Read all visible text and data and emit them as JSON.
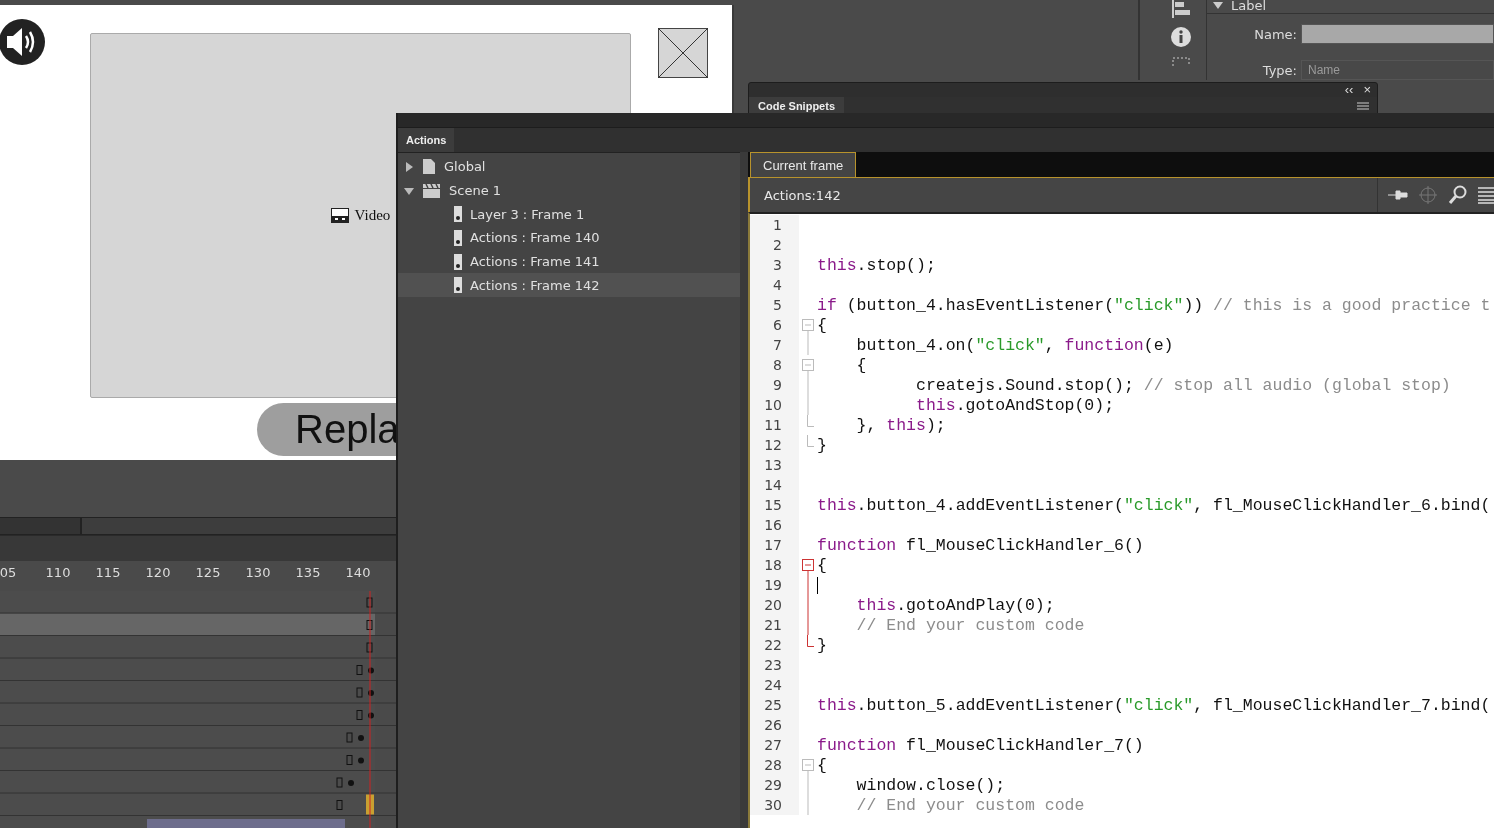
{
  "stage": {
    "video_label": "Video",
    "replay_button": "Repla"
  },
  "timeline": {
    "ruler": [
      "05",
      "110",
      "115",
      "120",
      "125",
      "130",
      "135",
      "140"
    ]
  },
  "properties": {
    "section": {
      "title": "Label",
      "expanded": true
    },
    "fields": [
      {
        "label": "Name:",
        "filled": true
      },
      {
        "label": "Type:",
        "filled": false,
        "placeholder": "Name"
      }
    ]
  },
  "code_snippets_panel": {
    "collapse": "‹‹",
    "close": "×",
    "tab": "Code Snippets"
  },
  "actions_panel": {
    "tab": "Actions",
    "tree": [
      {
        "label": "Global",
        "kind": "file",
        "expanded": false,
        "selected": false
      },
      {
        "label": "Scene 1",
        "kind": "scene",
        "expanded": true,
        "selected": false,
        "children": [
          {
            "label": "Layer 3 : Frame 1",
            "kind": "frame",
            "selected": false
          },
          {
            "label": "Actions : Frame 140",
            "kind": "frame",
            "selected": false
          },
          {
            "label": "Actions : Frame 141",
            "kind": "frame",
            "selected": false
          },
          {
            "label": "Actions : Frame 142",
            "kind": "frame",
            "selected": true
          }
        ]
      }
    ],
    "editor_tab": {
      "label": "Current frame",
      "selected": true
    },
    "location": "Actions:142",
    "code": [
      {
        "n": "1"
      },
      {
        "n": "2"
      },
      {
        "n": "3",
        "tokens": [
          {
            "kind": "kw",
            "s": "this"
          },
          {
            "kind": "p",
            "s": ".stop();"
          }
        ]
      },
      {
        "n": "4"
      },
      {
        "n": "5",
        "tokens": [
          {
            "kind": "kw",
            "s": "if"
          },
          {
            "kind": "p",
            "s": " (button_4.hasEventListener("
          },
          {
            "kind": "str",
            "s": "\"click\""
          },
          {
            "kind": "p",
            "s": ")) "
          },
          {
            "kind": "cmt",
            "s": "// this is a good practice t"
          }
        ]
      },
      {
        "n": "6",
        "fold": true,
        "in_fold": true,
        "tokens": [
          {
            "kind": "p",
            "s": "{"
          }
        ]
      },
      {
        "n": "7",
        "in_fold": true,
        "tokens": [
          {
            "kind": "p",
            "s": "    button_4.on("
          },
          {
            "kind": "str",
            "s": "\"click\""
          },
          {
            "kind": "p",
            "s": ", "
          },
          {
            "kind": "kw",
            "s": "function"
          },
          {
            "kind": "p",
            "s": "(e)"
          }
        ]
      },
      {
        "n": "8",
        "fold": true,
        "in_fold": true,
        "tokens": [
          {
            "kind": "p",
            "s": "    {"
          }
        ]
      },
      {
        "n": "9",
        "in_fold": true,
        "tokens": [
          {
            "kind": "p",
            "s": "          createjs.Sound.stop(); "
          },
          {
            "kind": "cmt",
            "s": "// stop all audio (global stop)"
          }
        ]
      },
      {
        "n": "10",
        "in_fold": true,
        "tokens": [
          {
            "kind": "kw",
            "s": "          this"
          },
          {
            "kind": "p",
            "s": ".gotoAndStop(0);"
          }
        ]
      },
      {
        "n": "11",
        "in_fold": true,
        "fold_end": true,
        "tokens": [
          {
            "kind": "p",
            "s": "    }, "
          },
          {
            "kind": "kw",
            "s": "this"
          },
          {
            "kind": "p",
            "s": ");"
          }
        ]
      },
      {
        "n": "12",
        "in_fold": true,
        "fold_end": true,
        "tokens": [
          {
            "kind": "p",
            "s": "}"
          }
        ]
      },
      {
        "n": "13"
      },
      {
        "n": "14"
      },
      {
        "n": "15",
        "tokens": [
          {
            "kind": "kw",
            "s": "this"
          },
          {
            "kind": "p",
            "s": ".button_4.addEventListener("
          },
          {
            "kind": "str",
            "s": "\"click\""
          },
          {
            "kind": "p",
            "s": ", fl_MouseClickHandler_6.bind("
          }
        ]
      },
      {
        "n": "16"
      },
      {
        "n": "17",
        "tokens": [
          {
            "kind": "kw",
            "s": "function"
          },
          {
            "kind": "p",
            "s": " fl_MouseClickHandler_6()"
          }
        ]
      },
      {
        "n": "18",
        "fold": true,
        "in_fold": true,
        "active": true,
        "tokens": [
          {
            "kind": "p",
            "s": "{"
          }
        ]
      },
      {
        "n": "19",
        "in_fold": true,
        "active": true,
        "cursor": true
      },
      {
        "n": "20",
        "in_fold": true,
        "active": true,
        "tokens": [
          {
            "kind": "kw",
            "s": "    this"
          },
          {
            "kind": "p",
            "s": ".gotoAndPlay(0);"
          }
        ]
      },
      {
        "n": "21",
        "in_fold": true,
        "active": true,
        "tokens": [
          {
            "kind": "cmt",
            "s": "    // End your custom code"
          }
        ]
      },
      {
        "n": "22",
        "in_fold": true,
        "fold_end": true,
        "active": true,
        "tokens": [
          {
            "kind": "p",
            "s": "}"
          }
        ]
      },
      {
        "n": "23"
      },
      {
        "n": "24"
      },
      {
        "n": "25",
        "tokens": [
          {
            "kind": "kw",
            "s": "this"
          },
          {
            "kind": "p",
            "s": ".button_5.addEventListener("
          },
          {
            "kind": "str",
            "s": "\"click\""
          },
          {
            "kind": "p",
            "s": ", fl_MouseClickHandler_7.bind("
          }
        ]
      },
      {
        "n": "26"
      },
      {
        "n": "27",
        "tokens": [
          {
            "kind": "kw",
            "s": "function"
          },
          {
            "kind": "p",
            "s": " fl_MouseClickHandler_7()"
          }
        ]
      },
      {
        "n": "28",
        "fold": true,
        "in_fold": true,
        "tokens": [
          {
            "kind": "p",
            "s": "{"
          }
        ]
      },
      {
        "n": "29",
        "in_fold": true,
        "tokens": [
          {
            "kind": "p",
            "s": "    window.close();"
          }
        ]
      },
      {
        "n": "30",
        "in_fold": true,
        "tokens": [
          {
            "kind": "cmt",
            "s": "    // End your custom code"
          }
        ]
      }
    ]
  }
}
